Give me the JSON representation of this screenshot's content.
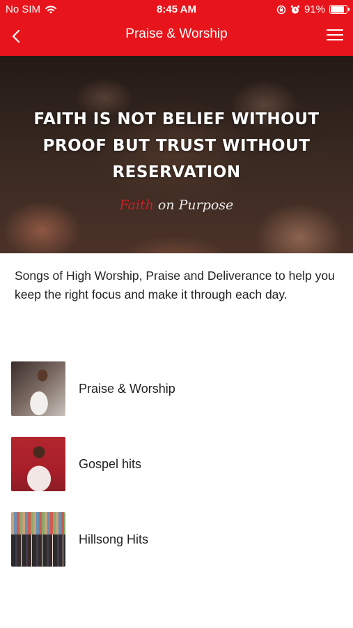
{
  "status_bar": {
    "carrier": "No SIM",
    "time": "8:45 AM",
    "battery_percent": "91%",
    "battery_level": 0.91
  },
  "nav": {
    "title": "Praise & Worship",
    "back_icon": "chevron-left-icon",
    "menu_icon": "hamburger-menu-icon"
  },
  "hero": {
    "quote": "FAITH IS NOT BELIEF WITHOUT PROOF BUT TRUST WITHOUT RESERVATION",
    "signature_part1": "Faith",
    "signature_part2": " on Purpose"
  },
  "intro": {
    "text": "Songs of High Worship, Praise and Deliverance to help you keep the right focus and make it through each day."
  },
  "playlists": [
    {
      "label": "Praise & Worship"
    },
    {
      "label": "Gospel hits"
    },
    {
      "label": "Hillsong Hits"
    }
  ],
  "colors": {
    "accent": "#e8141b"
  }
}
